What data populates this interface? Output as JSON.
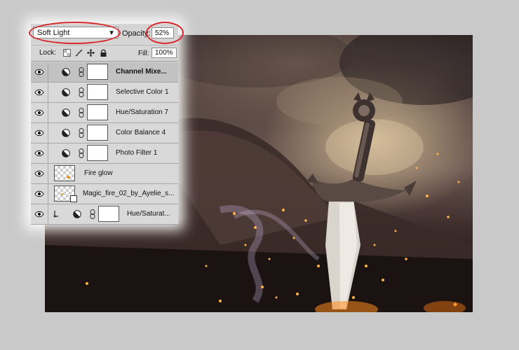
{
  "blend": {
    "mode": "Soft Light",
    "opacity_label": "Opacity:",
    "opacity_value": "52%"
  },
  "lock": {
    "label": "Lock:",
    "fill_label": "Fill:",
    "fill_value": "100%"
  },
  "layers": [
    {
      "name": "Channel Mixe...",
      "kind": "adjustment",
      "selected": true
    },
    {
      "name": "Selective Color 1",
      "kind": "adjustment",
      "selected": false
    },
    {
      "name": "Hue/Saturation 7",
      "kind": "adjustment",
      "selected": false
    },
    {
      "name": "Color Balance 4",
      "kind": "adjustment",
      "selected": false
    },
    {
      "name": "Photo Filter 1",
      "kind": "adjustment",
      "selected": false
    },
    {
      "name": "Fire glow",
      "kind": "pixel",
      "selected": false
    },
    {
      "name": "Magic_fire_02_by_Ayelie_s...",
      "kind": "smart-object",
      "selected": false
    },
    {
      "name": "Hue/Saturat...",
      "kind": "clipped-adjustment",
      "selected": false
    }
  ],
  "icons": {
    "visibility": "eye-icon",
    "adjustment": "half-circle-adjustment-icon",
    "link": "chain-link-icon",
    "clip": "clipping-arrow-icon",
    "lock_transparent": "lock-transparent-pixels-icon",
    "lock_image": "brush-icon",
    "lock_position": "move-icon",
    "lock_all": "padlock-icon"
  },
  "colors": {
    "annotation": "#d8282c",
    "panel": "#d8d8d8",
    "selected_row": "#c2c2c2",
    "background": "#c9c9c9"
  }
}
